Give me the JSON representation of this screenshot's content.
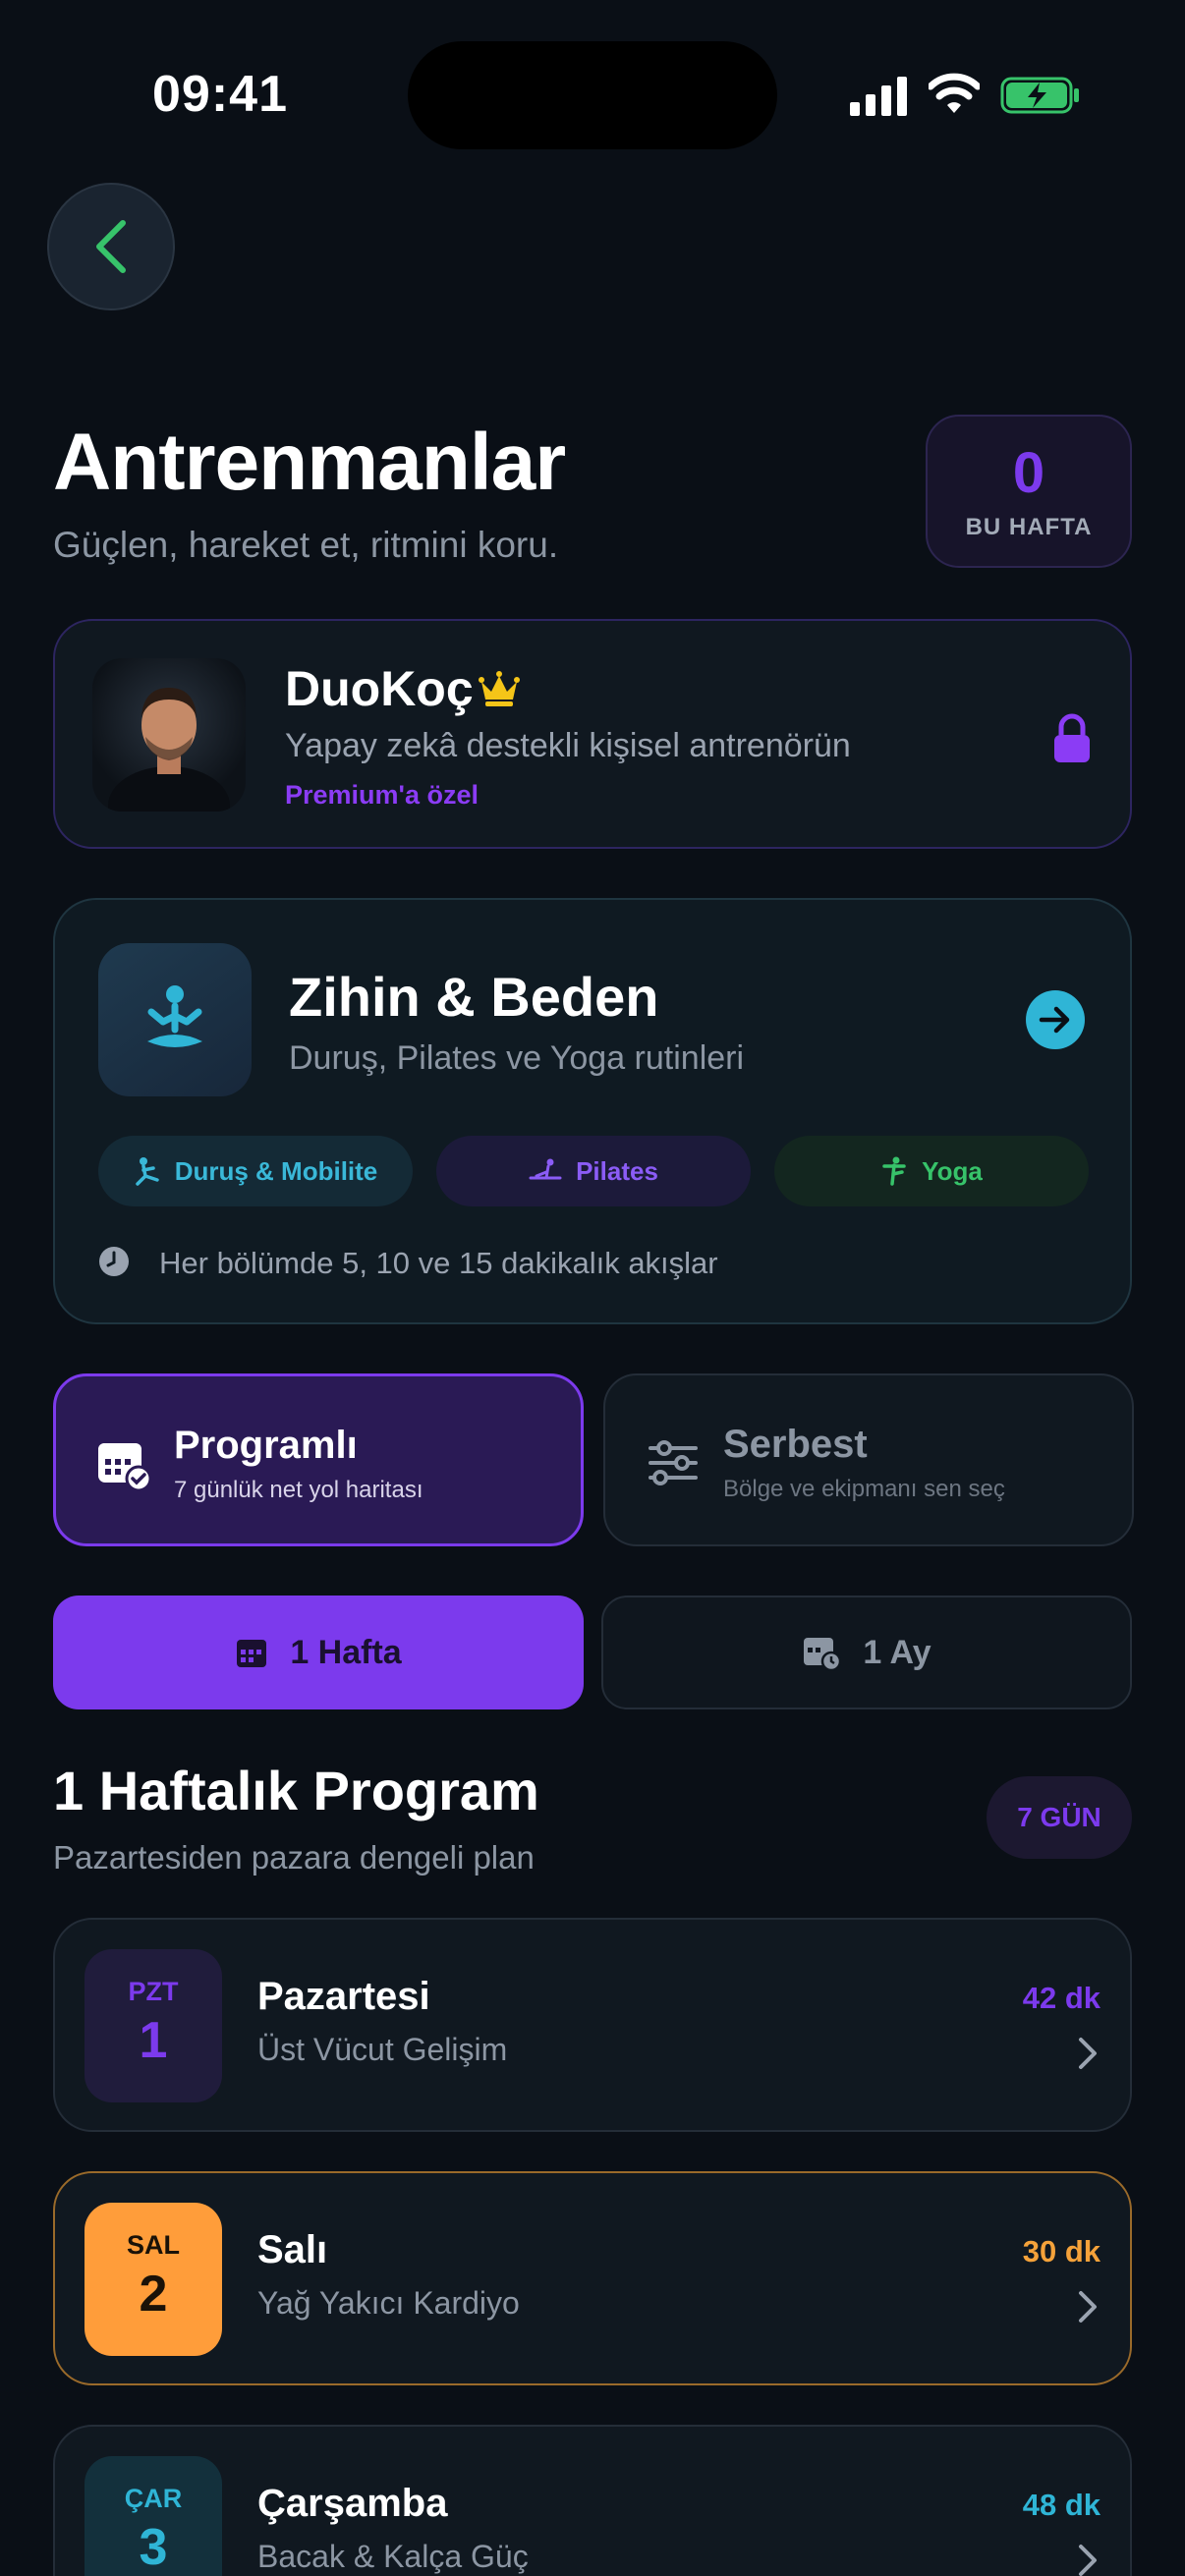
{
  "status": {
    "time": "09:41"
  },
  "header": {
    "title": "Antrenmanlar",
    "subtitle": "Güçlen, hareket et, ritmini koru.",
    "week_count": "0",
    "week_label": "BU HAFTA"
  },
  "coach": {
    "name": "DuoKoç",
    "description": "Yapay zekâ destekli kişisel antrenörün",
    "premium": "Premium'a özel"
  },
  "mind_body": {
    "title": "Zihin & Beden",
    "subtitle": "Duruş, Pilates ve Yoga rutinleri",
    "chips": [
      "Duruş & Mobilite",
      "Pilates",
      "Yoga"
    ],
    "note": "Her bölümde 5, 10 ve 15 dakikalık akışlar"
  },
  "modes": [
    {
      "title": "Programlı",
      "subtitle": "7 günlük net yol haritası"
    },
    {
      "title": "Serbest",
      "subtitle": "Bölge ve ekipmanı sen seç"
    }
  ],
  "durations": [
    "1 Hafta",
    "1 Ay"
  ],
  "program": {
    "title": "1 Haftalık Program",
    "subtitle": "Pazartesiden pazara dengeli plan",
    "badge": "7 GÜN",
    "days": [
      {
        "abbr": "PZT",
        "num": "1",
        "name": "Pazartesi",
        "focus": "Üst Vücut Gelişim",
        "minutes": "42 dk"
      },
      {
        "abbr": "SAL",
        "num": "2",
        "name": "Salı",
        "focus": "Yağ Yakıcı Kardiyo",
        "minutes": "30 dk"
      },
      {
        "abbr": "ÇAR",
        "num": "3",
        "name": "Çarşamba",
        "focus": "Bacak & Kalça Güç",
        "minutes": "48 dk"
      }
    ]
  },
  "colors": {
    "accent": "#7c3aed",
    "cyan": "#2fb5d6",
    "orange": "#ff9d3a",
    "green": "#37c36a",
    "gold": "#f5c518"
  }
}
